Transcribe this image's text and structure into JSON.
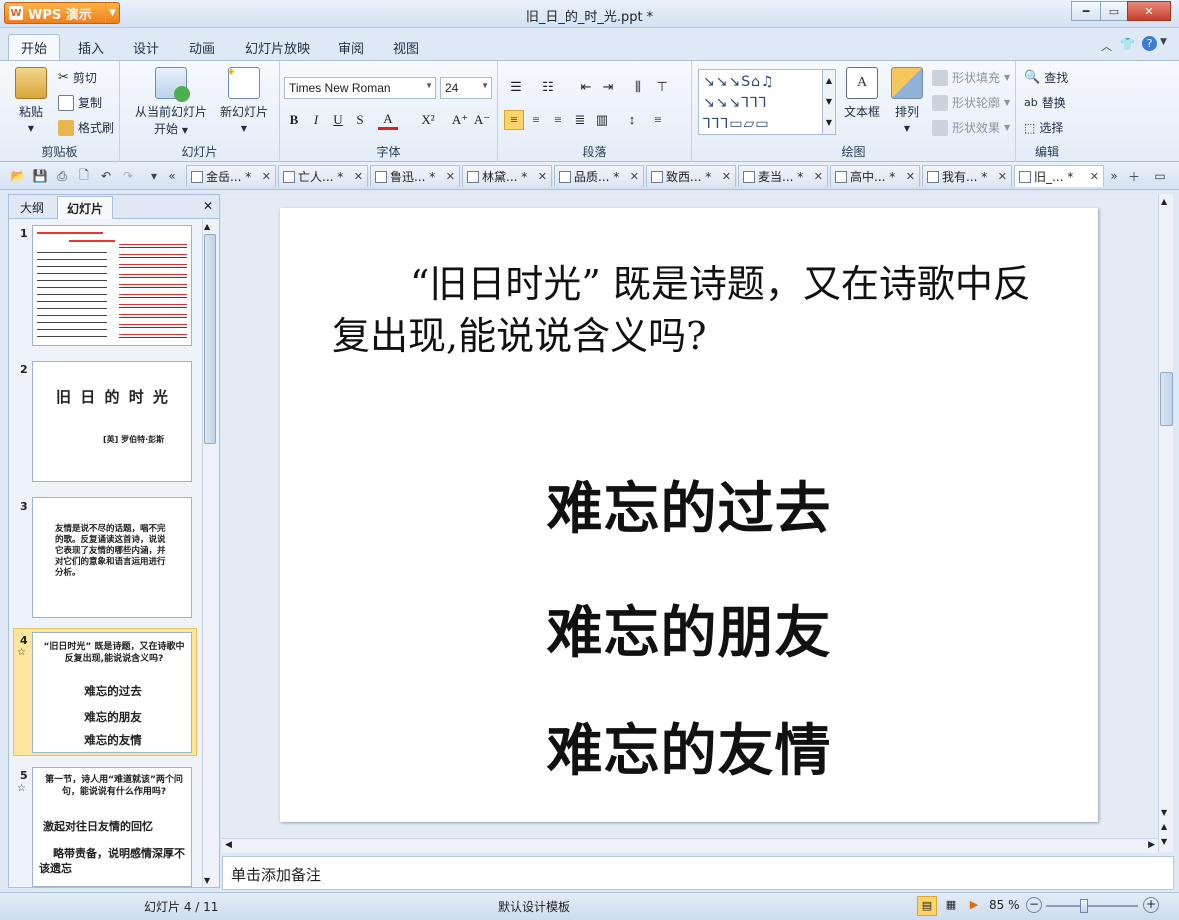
{
  "app": {
    "name": "WPS 演示",
    "doc_title": "旧_日_的_时_光.ppt *"
  },
  "menu": {
    "tabs": [
      "开始",
      "插入",
      "设计",
      "动画",
      "幻灯片放映",
      "审阅",
      "视图"
    ]
  },
  "ribbon": {
    "clipboard": {
      "paste": "粘贴",
      "cut": "剪切",
      "copy": "复制",
      "format_painter": "格式刷",
      "label": "剪贴板"
    },
    "slides": {
      "from_current": "从当前幻灯片",
      "start": "开始",
      "new_slide": "新幻灯片",
      "label": "幻灯片"
    },
    "font": {
      "name": "Times New Roman",
      "size": "24",
      "label": "字体"
    },
    "paragraph": {
      "label": "段落"
    },
    "drawing": {
      "textbox": "文本框",
      "arrange": "排列",
      "shape_fill": "形状填充",
      "shape_outline": "形状轮廓",
      "shape_effect": "形状效果",
      "label": "绘图"
    },
    "edit": {
      "find": "查找",
      "replace": "替换",
      "select": "选择",
      "label": "编辑"
    }
  },
  "doc_tabs": [
    "金岳... *",
    "亡人... *",
    "鲁迅... *",
    "林黛... *",
    "品质... *",
    "致西... *",
    "麦当... *",
    "高中... *",
    "我有... *",
    "旧_... *"
  ],
  "left_panel": {
    "tabs": [
      "大纲",
      "幻灯片"
    ],
    "thumbs": [
      {
        "num": "1"
      },
      {
        "num": "2",
        "title": "旧 日 的 时 光",
        "author": "[英]  罗伯特·彭斯"
      },
      {
        "num": "3",
        "text": "友情是说不尽的话题，唱不完的歌。反复诵读这首诗，说说它表现了友情的哪些内涵，并对它们的意象和语言运用进行分析。"
      },
      {
        "num": "4",
        "q": "“旧日时光” 既是诗题，又在诗歌中反复出现,能说说含义吗?",
        "lines": [
          "难忘的过去",
          "难忘的朋友",
          "难忘的友情"
        ]
      },
      {
        "num": "5",
        "q": "第一节，诗人用“难道就该”两个问句，能说说有什么作用吗?",
        "a1": "激起对往日友情的回忆",
        "a2": "略带责备，说明感情深厚不该遗忘"
      }
    ]
  },
  "slide": {
    "question": "“旧日时光” 既是诗题，又在诗歌中反复出现,能说说含义吗?",
    "lines": [
      "难忘的过去",
      "难忘的朋友",
      "难忘的友情"
    ]
  },
  "notes_placeholder": "单击添加备注",
  "status": {
    "slide_info": "幻灯片 4 / 11",
    "template": "默认设计模板",
    "zoom": "85 %"
  }
}
